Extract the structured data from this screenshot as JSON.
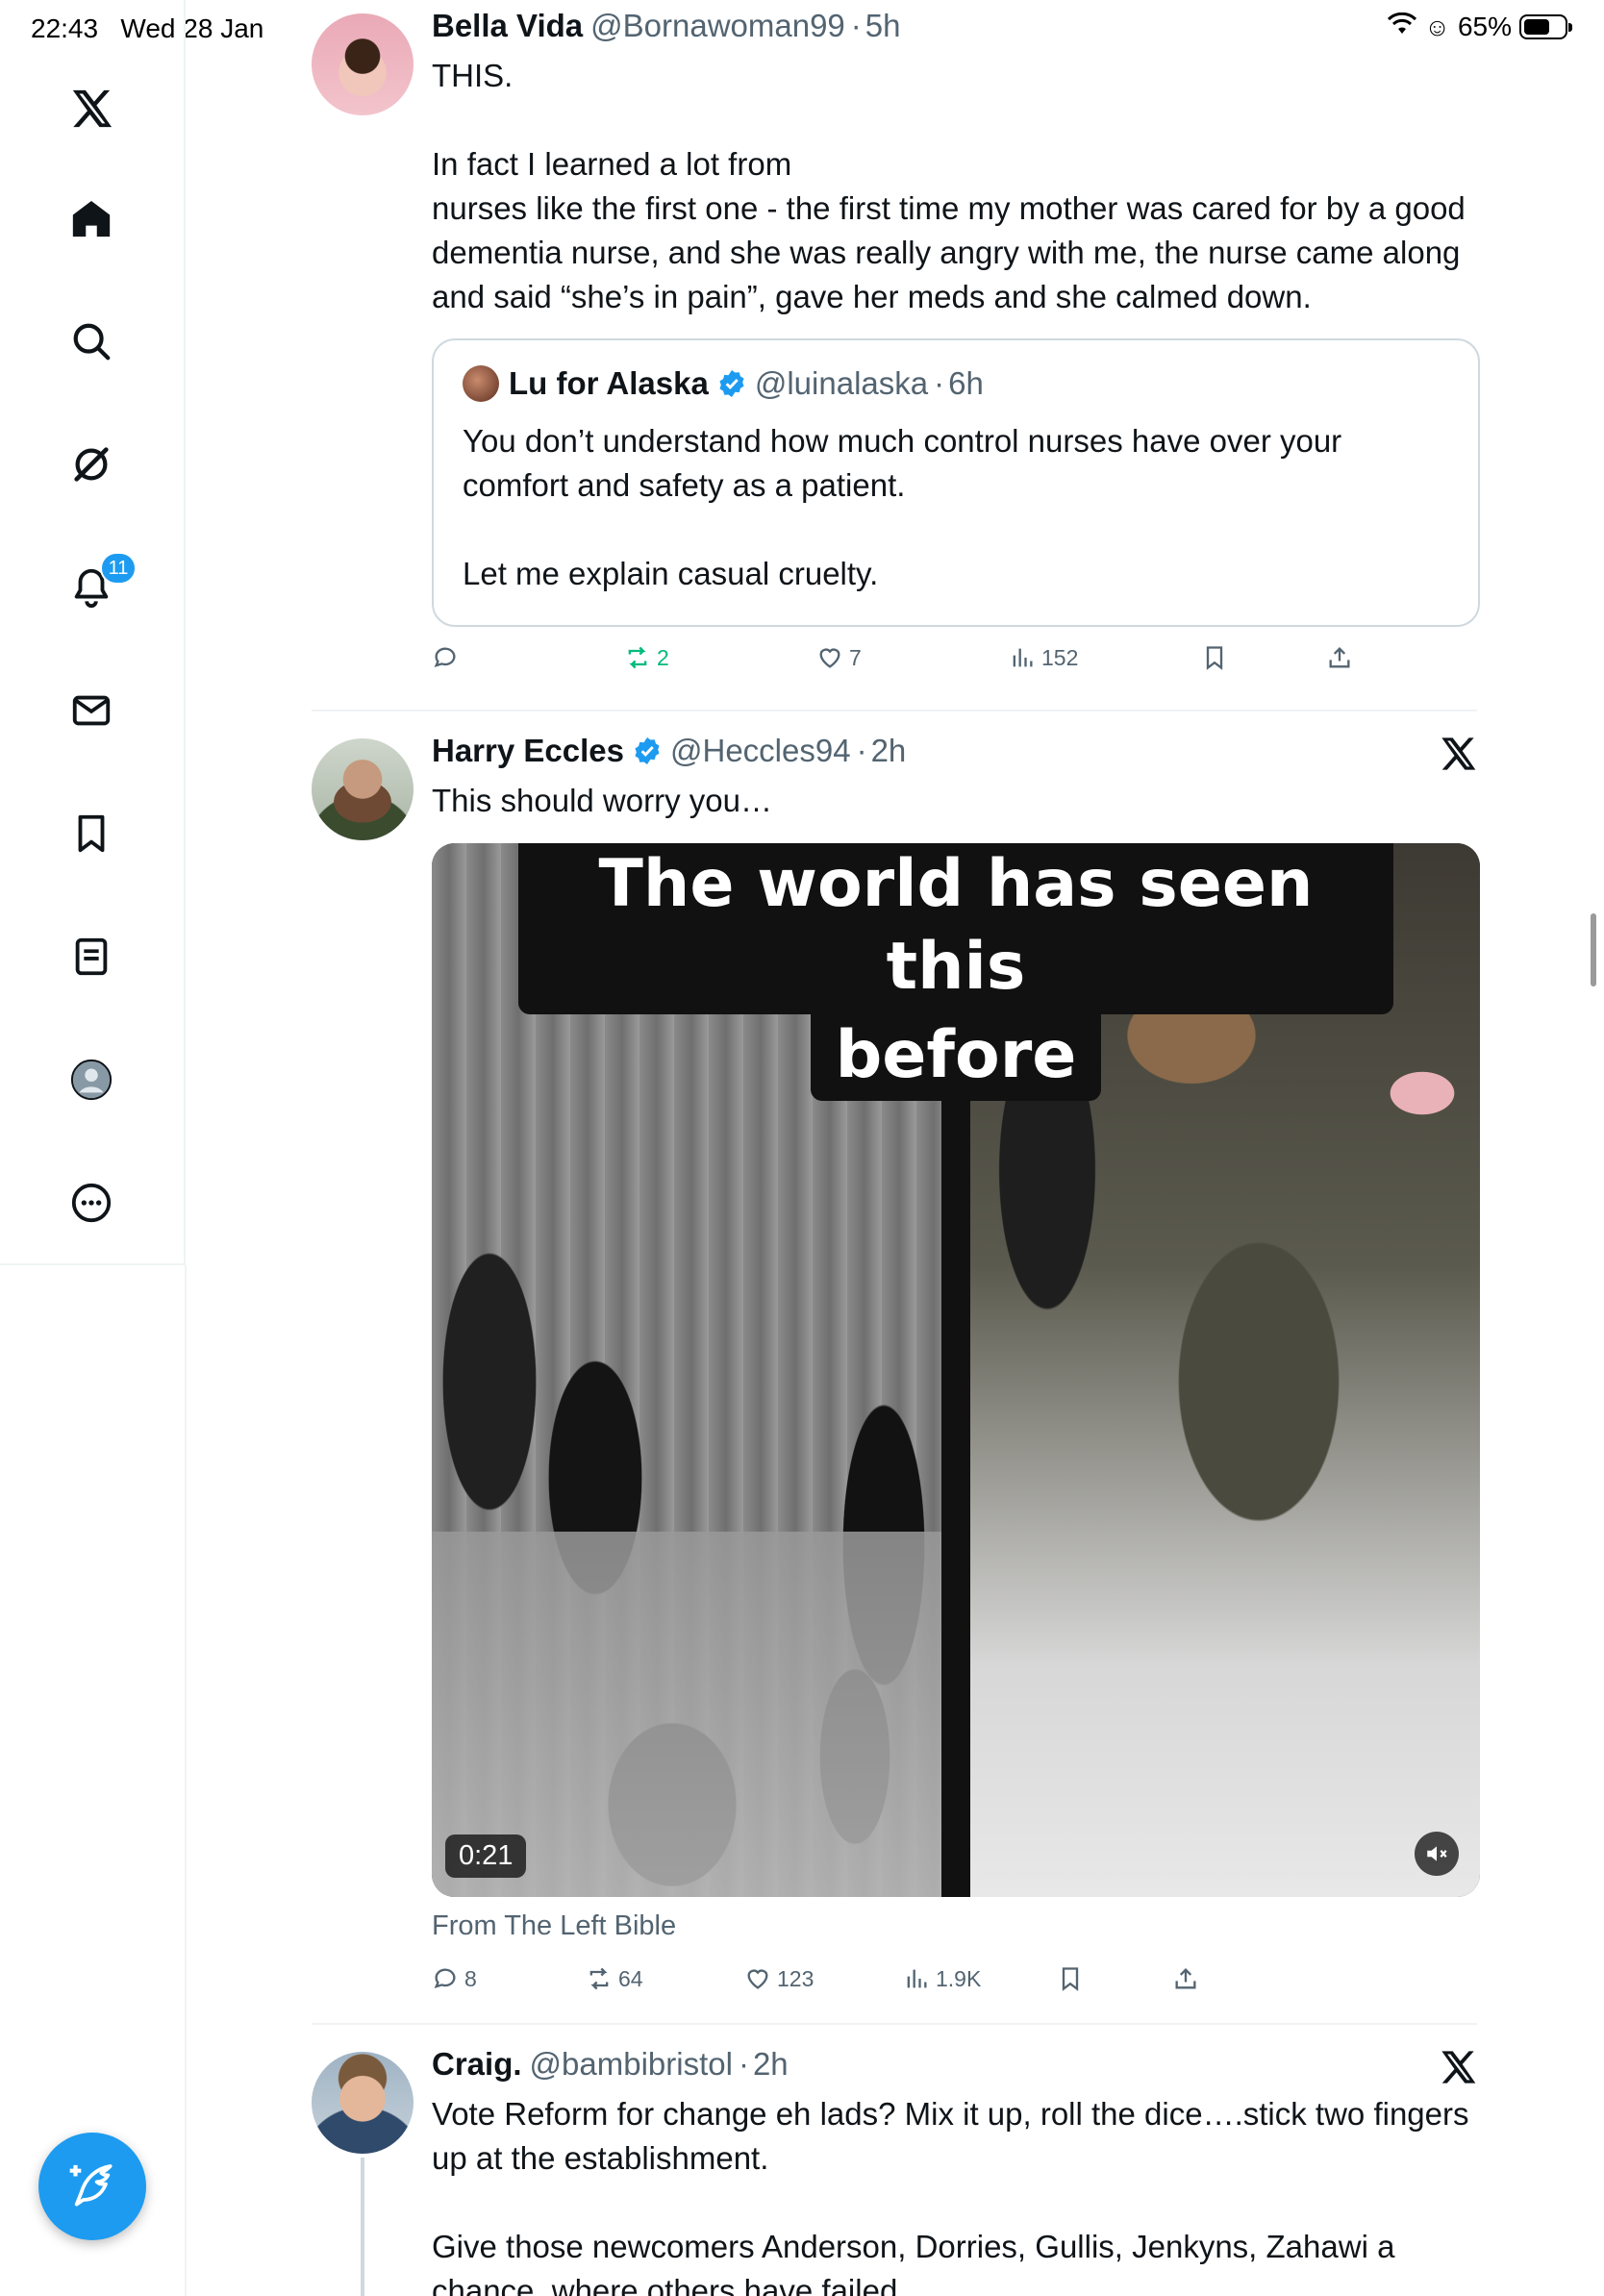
{
  "status_bar": {
    "time": "22:43",
    "date": "Wed 28 Jan",
    "battery": "65%"
  },
  "sidebar": {
    "items": [
      {
        "icon": "x-logo-icon"
      },
      {
        "icon": "home-icon"
      },
      {
        "icon": "search-icon"
      },
      {
        "icon": "grok-icon"
      },
      {
        "icon": "notifications-icon",
        "badge": "11"
      },
      {
        "icon": "messages-icon"
      },
      {
        "icon": "bookmarks-icon"
      },
      {
        "icon": "lists-icon"
      },
      {
        "icon": "profile-icon"
      },
      {
        "icon": "more-icon"
      }
    ],
    "compose_icon": "compose-post-icon"
  },
  "posts": [
    {
      "name": "Bella Vida",
      "handle": "@Bornawoman99",
      "time": "5h",
      "text": "THIS.\n\nIn fact I learned a lot from\nnurses like the first one - the first time my mother was cared for by a good dementia nurse, and she was really angry with me, the nurse came along and said “she’s in pain”, gave her meds and she calmed down.",
      "quote": {
        "name": "Lu for Alaska",
        "handle": "@luinalaska",
        "time": "6h",
        "verified": true,
        "text": "You don’t understand how much control nurses have over your comfort and safety as a patient.\n\nLet me explain casual cruelty."
      },
      "actions": {
        "replies": "",
        "reposts": "2",
        "likes": "7",
        "views": "152"
      }
    },
    {
      "name": "Harry Eccles",
      "handle": "@Heccles94",
      "time": "2h",
      "verified": true,
      "text": "This should worry you…",
      "media": {
        "caption_line1": "The world has seen this",
        "caption_line2": "before",
        "duration": "0:21"
      },
      "source": "From The Left Bible",
      "actions": {
        "replies": "8",
        "reposts": "64",
        "likes": "123",
        "views": "1.9K"
      }
    },
    {
      "name": "Craig.",
      "handle": "@bambibristol",
      "time": "2h",
      "text": "Vote Reform for change eh lads? Mix it up, roll the dice….stick two fingers up at the establishment.\n\nGive those newcomers Anderson, Dorries, Gullis, Jenkyns, Zahawi a chance, where others have failed."
    }
  ],
  "colors": {
    "accent": "#1d9bf0",
    "repost_active": "#00ba7c",
    "secondary_text": "#536471",
    "border": "#cfd9de"
  }
}
